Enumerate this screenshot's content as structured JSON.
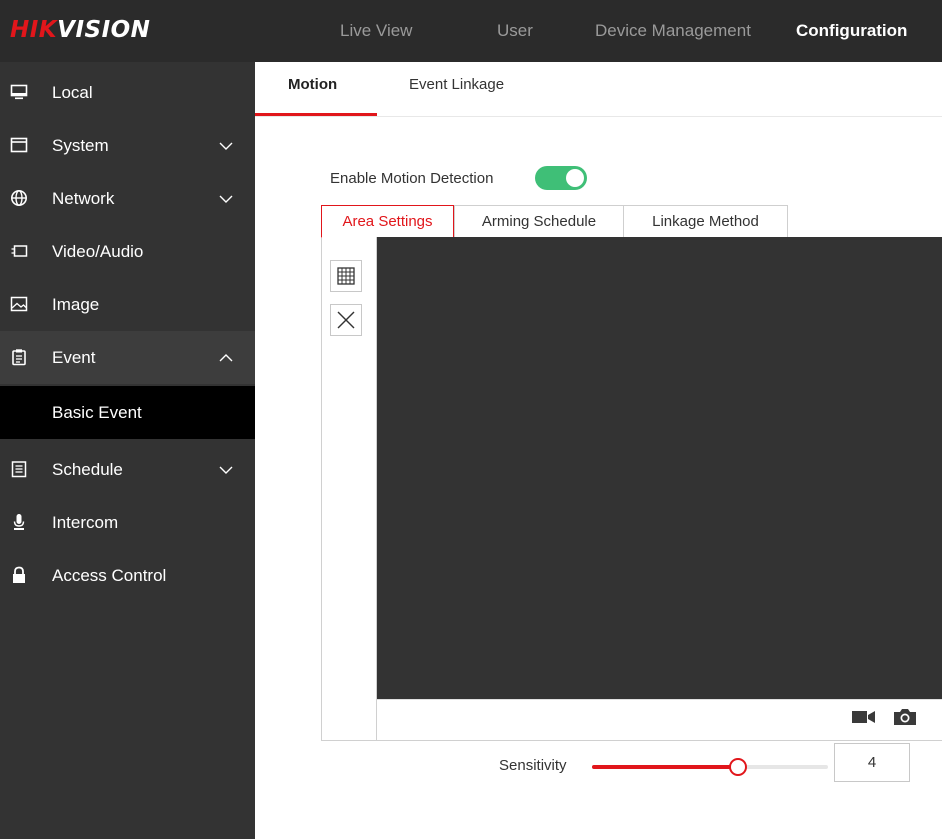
{
  "brand": {
    "logo_red": "HIK",
    "logo_white": "VISION"
  },
  "topnav": [
    {
      "label": "Live View",
      "active": false
    },
    {
      "label": "User",
      "active": false
    },
    {
      "label": "Device Management",
      "active": false
    },
    {
      "label": "Configuration",
      "active": true
    }
  ],
  "sidebar": {
    "items": [
      {
        "label": "Local",
        "icon": "monitor-icon",
        "chevron": "none"
      },
      {
        "label": "System",
        "icon": "window-icon",
        "chevron": "down"
      },
      {
        "label": "Network",
        "icon": "globe-icon",
        "chevron": "down"
      },
      {
        "label": "Video/Audio",
        "icon": "video-icon",
        "chevron": "none"
      },
      {
        "label": "Image",
        "icon": "image-icon",
        "chevron": "none"
      },
      {
        "label": "Event",
        "icon": "clipboard-icon",
        "chevron": "up",
        "expanded": true
      },
      {
        "label": "Schedule",
        "icon": "calendar-icon",
        "chevron": "down"
      },
      {
        "label": "Intercom",
        "icon": "microphone-icon",
        "chevron": "none"
      },
      {
        "label": "Access Control",
        "icon": "lock-icon",
        "chevron": "none"
      }
    ],
    "subitem": {
      "label": "Basic Event",
      "selected": true
    }
  },
  "tabs": [
    {
      "label": "Motion",
      "active": true
    },
    {
      "label": "Event Linkage",
      "active": false
    }
  ],
  "motion": {
    "enable_label": "Enable Motion Detection",
    "enabled": true
  },
  "subtabs": [
    {
      "label": "Area Settings",
      "active": true
    },
    {
      "label": "Arming Schedule",
      "active": false
    },
    {
      "label": "Linkage Method",
      "active": false
    }
  ],
  "tools": [
    {
      "icon": "grid-icon"
    },
    {
      "icon": "close-icon"
    }
  ],
  "video_controls": [
    {
      "icon": "record-icon"
    },
    {
      "icon": "snapshot-icon"
    }
  ],
  "sensitivity": {
    "label": "Sensitivity",
    "value": "4",
    "slider_fraction": 0.62
  },
  "colors": {
    "accent": "#e1161b",
    "toggle_on": "#3fbf77",
    "topbar": "#2b2b2b",
    "sidebar": "#333333",
    "video_bg": "#333333"
  }
}
